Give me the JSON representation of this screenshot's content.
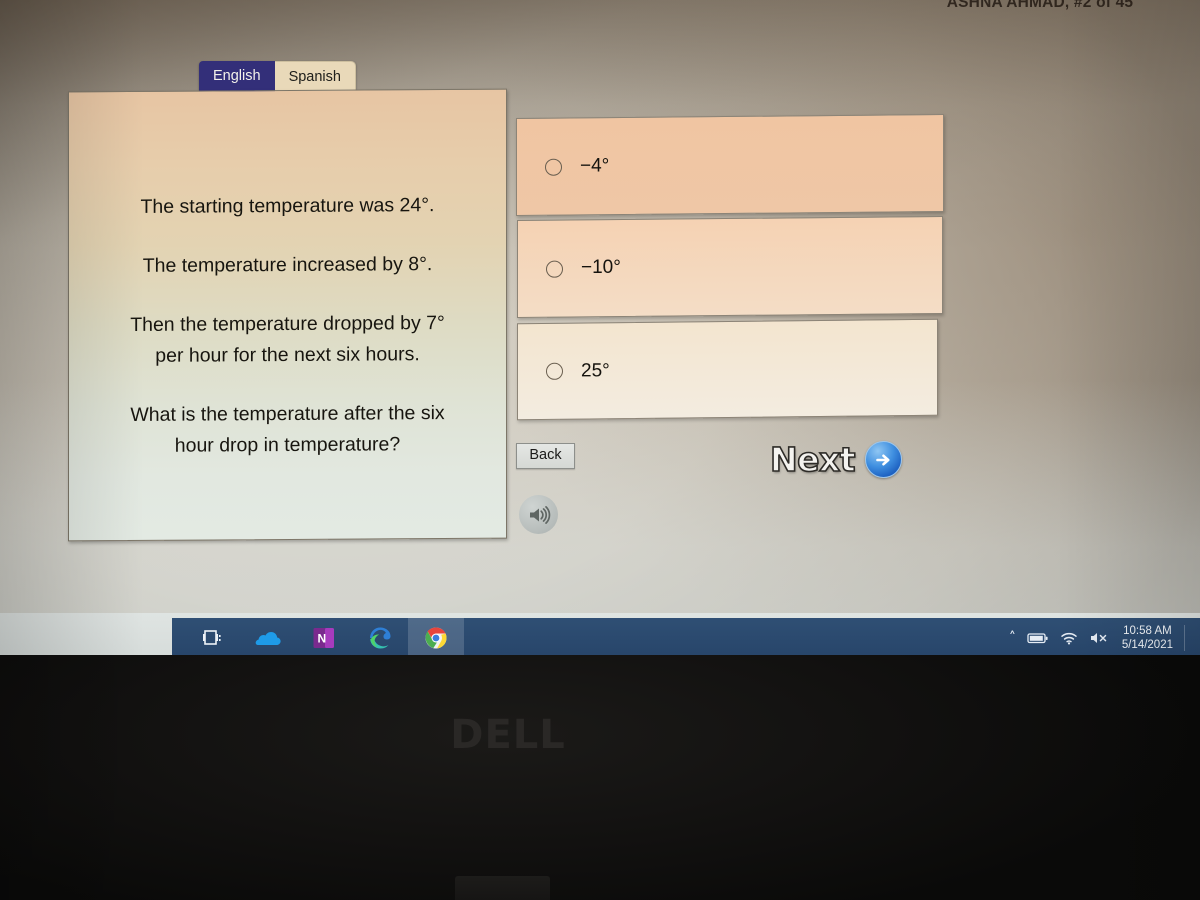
{
  "screen": {
    "student_banner": "ASHNA AHMAD, #2 of 45",
    "language_tabs": [
      {
        "label": "English",
        "state": "active"
      },
      {
        "label": "Spanish",
        "state": "inactive"
      }
    ],
    "question": {
      "lines": [
        "The starting temperature was 24°.",
        "The temperature increased by 8°.",
        "Then the temperature dropped by 7° per hour for the next six hours.",
        "What is the temperature after the six hour drop in temperature?"
      ],
      "line1": "The starting temperature was 24°.",
      "line2": "The temperature increased by 8°.",
      "line3a": "Then the temperature dropped by 7°",
      "line3b": "per hour for the next six hours.",
      "line4a": "What is the temperature after the six",
      "line4b": "hour drop in temperature?"
    },
    "answers": [
      {
        "label": "−4°",
        "selected": false
      },
      {
        "label": "−10°",
        "selected": false
      },
      {
        "label": "25°",
        "selected": false
      }
    ],
    "controls": {
      "back_label": "Back",
      "next_label": "Next",
      "speaker_icon": "speaker-icon",
      "next_arrow_icon": "arrow-right-circle-icon"
    }
  },
  "taskbar": {
    "items": [
      {
        "name": "task-view-icon",
        "label": "Task View"
      },
      {
        "name": "onedrive-icon",
        "label": "OneDrive"
      },
      {
        "name": "onenote-icon",
        "label": "OneNote"
      },
      {
        "name": "edge-icon",
        "label": "Microsoft Edge"
      },
      {
        "name": "chrome-icon",
        "label": "Google Chrome"
      }
    ],
    "tray": {
      "chevron": "˄",
      "battery_icon": "battery-icon",
      "wifi_icon": "wifi-icon",
      "volume_icon": "volume-muted-icon",
      "time": "10:58 AM",
      "date": "5/14/2021"
    }
  },
  "hardware": {
    "brand": "DELL"
  },
  "colors": {
    "tab_active_bg": "#332f79",
    "tab_inactive_bg": "#e9d9b9",
    "option_bg_1": "#efc7a6",
    "option_bg_2": "#f4ddc6",
    "option_bg_3": "#f3ece0",
    "taskbar_bg": "#2f4f74",
    "next_arrow_blue": "#1c5fc0"
  }
}
